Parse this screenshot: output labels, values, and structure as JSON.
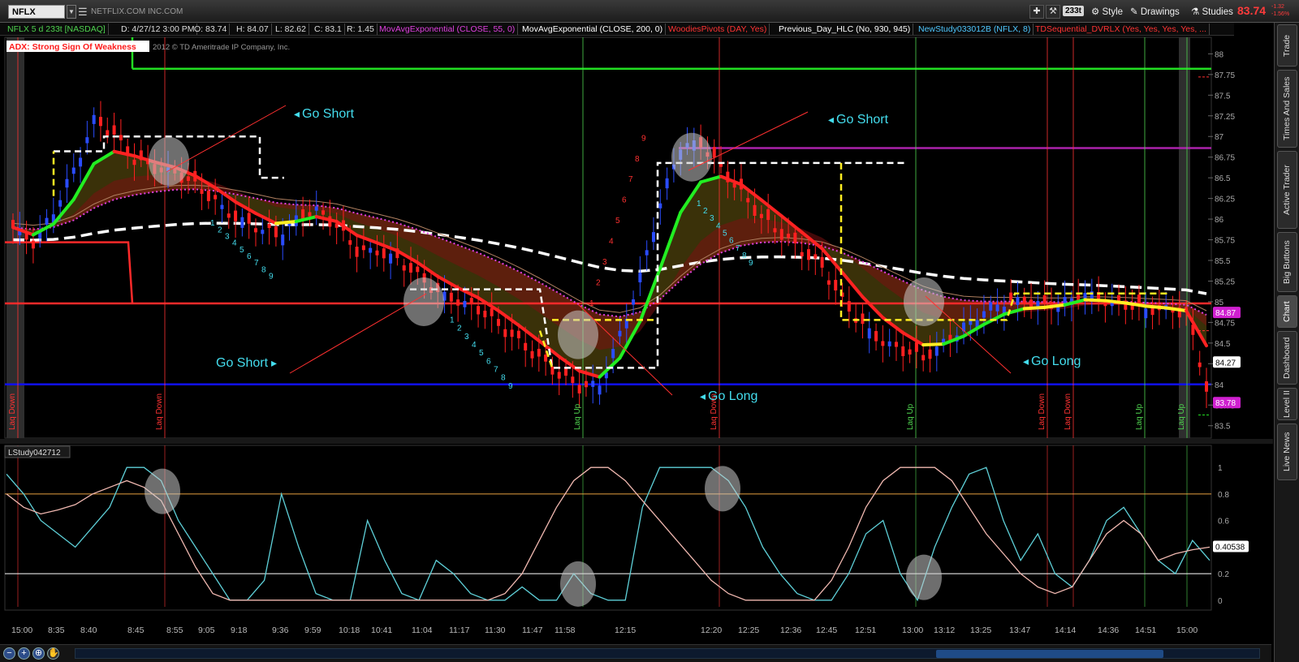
{
  "toolbar": {
    "symbol": "NFLX",
    "company": "NETFLIX.COM INC.COM",
    "aggregation_badge": "233t",
    "style_label": "Style",
    "drawings_label": "Drawings",
    "studies_label": "Studies",
    "last_price": "83.74",
    "change_abs": "-1.32",
    "change_pct": "-1.56%"
  },
  "study_bar": [
    {
      "text": "NFLX 5 d 233t [NASDAQ]",
      "color": "#4fd44f"
    },
    {
      "text": "D: 4/27/12 3:00 PM",
      "color": "#dddddd"
    },
    {
      "text": "O: 83.74",
      "color": "#dddddd"
    },
    {
      "text": "H: 84.07",
      "color": "#dddddd"
    },
    {
      "text": "L: 82.62",
      "color": "#dddddd"
    },
    {
      "text": "C: 83.1",
      "color": "#dddddd"
    },
    {
      "text": "R: 1.45",
      "color": "#dddddd"
    },
    {
      "text": "MovAvgExponential (CLOSE, 55, 0)",
      "color": "#e040e0"
    },
    {
      "text": "MovAvgExponential (CLOSE, 200, 0)",
      "color": "#ffffff"
    },
    {
      "text": "WoodiesPivots (DAY, Yes)",
      "color": "#ff3333"
    },
    {
      "text": "Previous_Day_HLC (No, 930, 945)",
      "color": "#ffffff"
    },
    {
      "text": "NewStudy033012B (NFLX, 8)",
      "color": "#4fc8ff"
    },
    {
      "text": "TDSequential_DVRLX (Yes, Yes, Yes, Yes, ...",
      "color": "#ff3333"
    }
  ],
  "adx_label": "ADX:  Strong Sign Of Weakness",
  "copyright": "2012 © TD Ameritrade IP Company, Inc.",
  "lower_study_label": "LStudy042712",
  "side_tabs": [
    "Trade",
    "Times And Sales",
    "Active Trader",
    "Big Buttons",
    "Chart",
    "Dashboard",
    "Level II",
    "Live News"
  ],
  "active_side_tab": "Chart",
  "annotations": {
    "go_short_1": "Go Short",
    "go_short_2": "Go Short",
    "go_short_3": "Go Short",
    "go_long_1": "Go Long",
    "go_long_2": "Go Long"
  },
  "vertical_markers": [
    {
      "label": "Laq Down",
      "x_label": "8:40",
      "color": "#ff3333"
    },
    {
      "label": "Laq Down",
      "x_label": "8:55",
      "color": "#ff3333"
    },
    {
      "label": "Laq Up",
      "x_label": "11:58",
      "color": "#4fd44f"
    },
    {
      "label": "Laq Down",
      "x_label": "12:20",
      "color": "#ff3333"
    },
    {
      "label": "Laq Up",
      "x_label": "13:00",
      "color": "#4fd44f"
    },
    {
      "label": "Laq Down",
      "x_label": "14:14",
      "color": "#ff3333"
    },
    {
      "label": "Laq Down",
      "x_label": "14:14",
      "color": "#ff3333"
    },
    {
      "label": "Laq Up",
      "x_label": "14:51",
      "color": "#4fd44f"
    },
    {
      "label": "Laq Up",
      "x_label": "15:00",
      "color": "#4fd44f"
    }
  ],
  "price_badges": [
    {
      "value": "84.87",
      "bg": "#d020d0",
      "fg": "#ffffff",
      "price": 84.87
    },
    {
      "value": "84.27",
      "bg": "#ffffff",
      "fg": "#000000",
      "price": 84.27
    },
    {
      "value": "83.78",
      "bg": "#d020d0",
      "fg": "#ffffff",
      "price": 83.78
    }
  ],
  "lower_badge": {
    "value": "0.40538",
    "bg": "#ffffff",
    "fg": "#000000",
    "level": 0.40538
  },
  "colors": {
    "up_candle": "#2a4cff",
    "down_candle": "#ff2020",
    "ema55": "#e040e0",
    "ema200": "#ffffff",
    "pivot_red": "#ff2a2a",
    "pivot_green": "#22dd22",
    "support_blue": "#1010ff",
    "cyan_text": "#44ddee",
    "lower_cyan": "#5ed0d8",
    "lower_pink": "#f0b8b0"
  },
  "chart_data": [
    {
      "type": "candlestick",
      "title": "NFLX 5 d 233t [NASDAQ]",
      "x_ticks": [
        "15:00",
        "8:35",
        "8:40",
        "8:45",
        "8:55",
        "9:05",
        "9:18",
        "9:36",
        "9:59",
        "10:18",
        "10:41",
        "11:04",
        "11:17",
        "11:30",
        "11:47",
        "11:58",
        "12:15",
        "12:20",
        "12:25",
        "12:36",
        "12:45",
        "12:51",
        "13:00",
        "13:12",
        "13:25",
        "13:47",
        "14:14",
        "14:36",
        "14:51",
        "15:00"
      ],
      "y_ticks": [
        83.5,
        83.75,
        84,
        84.25,
        84.5,
        84.75,
        85,
        85.25,
        85.5,
        85.75,
        86,
        86.25,
        86.5,
        86.75,
        87,
        87.25,
        87.5,
        87.75,
        88
      ],
      "ylim": [
        83.35,
        88.2
      ],
      "close_path": [
        85.9,
        85.7,
        86.1,
        86.6,
        87.2,
        87.0,
        86.7,
        86.6,
        86.55,
        86.4,
        86.2,
        86.0,
        85.9,
        85.8,
        86.0,
        86.1,
        85.9,
        85.6,
        85.6,
        85.5,
        85.3,
        85.1,
        85.0,
        84.9,
        84.7,
        84.5,
        84.3,
        84.1,
        83.95,
        84.0,
        84.6,
        85.3,
        86.2,
        86.9,
        86.9,
        86.6,
        86.3,
        86.0,
        85.8,
        85.6,
        85.4,
        85.0,
        84.7,
        84.5,
        84.4,
        84.3,
        84.5,
        84.7,
        84.9,
        85.0,
        85.0,
        84.95,
        85.0,
        85.1,
        85.0,
        84.95,
        84.9,
        84.9,
        84.85,
        83.95
      ],
      "horizontal_levels": [
        {
          "name": "pivot green top",
          "price": 87.82,
          "color": "#22dd22"
        },
        {
          "name": "pivot red mid",
          "price": 84.98,
          "color": "#ff2a2a"
        },
        {
          "name": "support blue",
          "price": 84.0,
          "color": "#1010ff"
        },
        {
          "name": "prev day high",
          "price": 86.86,
          "color": "#aa22aa"
        }
      ]
    },
    {
      "type": "line",
      "title": "LStudy042712",
      "y_ticks": [
        0,
        0.2,
        0.4,
        0.6,
        0.8,
        1
      ],
      "ylim": [
        -0.05,
        1.05
      ],
      "levels": [
        0.8,
        0.2
      ],
      "series": [
        {
          "values": [
            0.95,
            0.8,
            0.6,
            0.5,
            0.4,
            0.55,
            0.7,
            1.0,
            1.0,
            0.9,
            0.6,
            0.4,
            0.2,
            0.0,
            0.0,
            0.15,
            0.8,
            0.4,
            0.05,
            0.0,
            0.0,
            0.6,
            0.3,
            0.05,
            0.0,
            0.3,
            0.2,
            0.05,
            0.0,
            0.0,
            0.1,
            0.0,
            0.0,
            0.2,
            0.05,
            0.0,
            0.0,
            0.7,
            1.0,
            1.0,
            1.0,
            1.0,
            0.9,
            0.7,
            0.4,
            0.2,
            0.05,
            0.0,
            0.0,
            0.2,
            0.5,
            0.6,
            0.2,
            0.0,
            0.4,
            0.7,
            0.95,
            1.0,
            0.6,
            0.3,
            0.5,
            0.2,
            0.1,
            0.3,
            0.6,
            0.7,
            0.5,
            0.3,
            0.2,
            0.45,
            0.3
          ]
        },
        {
          "values": [
            0.8,
            0.7,
            0.65,
            0.68,
            0.72,
            0.8,
            0.85,
            0.9,
            0.85,
            0.75,
            0.5,
            0.25,
            0.05,
            0.0,
            0.0,
            0.0,
            0.0,
            0.0,
            0.0,
            0.0,
            0.0,
            0.0,
            0.0,
            0.0,
            0.0,
            0.0,
            0.0,
            0.0,
            0.0,
            0.05,
            0.2,
            0.45,
            0.7,
            0.9,
            1.0,
            1.0,
            0.9,
            0.75,
            0.6,
            0.45,
            0.3,
            0.15,
            0.05,
            0.0,
            0.0,
            0.0,
            0.0,
            0.0,
            0.15,
            0.4,
            0.7,
            0.9,
            1.0,
            1.0,
            1.0,
            0.9,
            0.7,
            0.5,
            0.35,
            0.2,
            0.1,
            0.05,
            0.1,
            0.3,
            0.5,
            0.6,
            0.5,
            0.3,
            0.35,
            0.38,
            0.4
          ]
        }
      ]
    }
  ]
}
